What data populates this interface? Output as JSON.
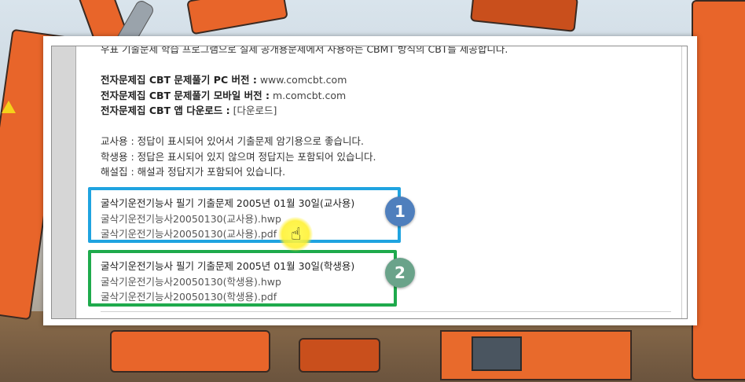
{
  "document": {
    "cut_line": "우표 기출문제 학습 프로그램으로 실제 공개용문제에서 사용하는 CBMT 방식의 CBT를 제공합니다.",
    "links": [
      {
        "label": "전자문제집 CBT 문제풀기 PC 버전 :",
        "value": "www.comcbt.com"
      },
      {
        "label": "전자문제집 CBT 문제풀기 모바일 버전 :",
        "value": "m.comcbt.com"
      },
      {
        "label": "전자문제집 CBT 앱 다운로드 :",
        "value": "[다운로드]"
      }
    ],
    "notes": [
      "교사용 : 정답이 표시되어 있어서 기출문제 암기용으로 좋습니다.",
      "학생용 : 정답은 표시되어 있지 않으며 정답지는 포함되어 있습니다.",
      "해설집 : 해설과 정답지가 포함되어 있습니다."
    ],
    "groups": [
      {
        "title": "굴삭기운전기능사 필기 기출문제 2005년 01월 30일(교사용)",
        "hwp": "굴삭기운전기능사20050130(교사용).hwp",
        "pdf": "굴삭기운전기능사20050130(교사용).pdf"
      },
      {
        "title": "굴삭기운전기능사 필기 기출문제 2005년 01월 30일(학생용)",
        "hwp": "굴삭기운전기능사20050130(학생용).hwp",
        "pdf": "굴삭기운전기능사20050130(학생용).pdf"
      }
    ]
  },
  "badges": [
    "1",
    "2"
  ],
  "colors": {
    "box_blue": "#1fa3e0",
    "box_green": "#1eaa4c",
    "badge_one": "#4f7fbd",
    "badge_two": "#6aa38a",
    "cursor_highlight": "#fff450"
  },
  "icons": {
    "cursor": "hand-pointer-icon"
  }
}
